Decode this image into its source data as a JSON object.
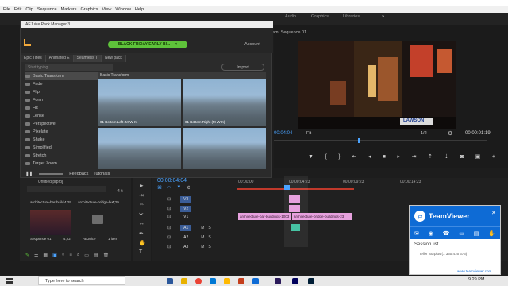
{
  "menu": [
    "File",
    "Edit",
    "Clip",
    "Sequence",
    "Markers",
    "Graphics",
    "View",
    "Window",
    "Help"
  ],
  "workspaces": [
    "Audio",
    "Graphics",
    "Libraries"
  ],
  "aejuice": {
    "title": "AEJuice Pack Manager 3",
    "promo_button": "BLACK FRIDAY EARLY BI...",
    "account": "Account",
    "tabs": [
      "Epic Titles",
      "Animated E",
      "Seamless T",
      "New pack"
    ],
    "search_placeholder": "Start typing...",
    "import_label": "Import",
    "categories": [
      "Basic Transform",
      "Fade",
      "Flip",
      "Form",
      "Hit",
      "Lense",
      "Perspective",
      "Pixelate",
      "Shake",
      "Simplified",
      "Stretch",
      "Target Zoom"
    ],
    "preview_heading": "Basic Transform",
    "thumbs": [
      {
        "label": "01 Bottom Left (M-W-K)"
      },
      {
        "label": "01 Bottom Right (M-W-K)"
      },
      {
        "label": ""
      },
      {
        "label": ""
      }
    ],
    "feedback": "Feedback",
    "tutorials": "Tutorials"
  },
  "program": {
    "title": "am: Sequence 01",
    "current_tc": "00:04:04",
    "fit": "Fit",
    "fraction": "1/2",
    "duration_tc": "00:00:01:19",
    "sign_text": "LAWSON"
  },
  "project": {
    "file": "Untitled.prproj",
    "count": "4 it",
    "items": [
      {
        "name": "architecture-bar-build...",
        "dur": "4;29"
      },
      {
        "name": "architecture-bridge-bu...",
        "dur": "4;29"
      },
      {
        "name": "Sequence 01",
        "dur": "4;22"
      },
      {
        "name": "AEJuice",
        "dur": "1 item"
      }
    ]
  },
  "timeline": {
    "timecode": "00:00:04:04",
    "ruler": [
      "00:00:00",
      "00:00:04:23",
      "00:00:09:23",
      "00:00:14:23"
    ],
    "tracks_video": [
      "V3",
      "V2",
      "V1"
    ],
    "tracks_audio": [
      "A1",
      "A2",
      "A3"
    ],
    "clip1": "architecture-bar-buildings-1003",
    "clip2": "architecture-bridge-buildings-23"
  },
  "teamviewer": {
    "title": "TeamViewer",
    "session_list": "Session list",
    "session_item": "Teller Surplus (1 330 416 676)",
    "url": "www.teamviewer.com"
  },
  "taskbar": {
    "search": "Type here to search",
    "time": "9:29 PM"
  }
}
